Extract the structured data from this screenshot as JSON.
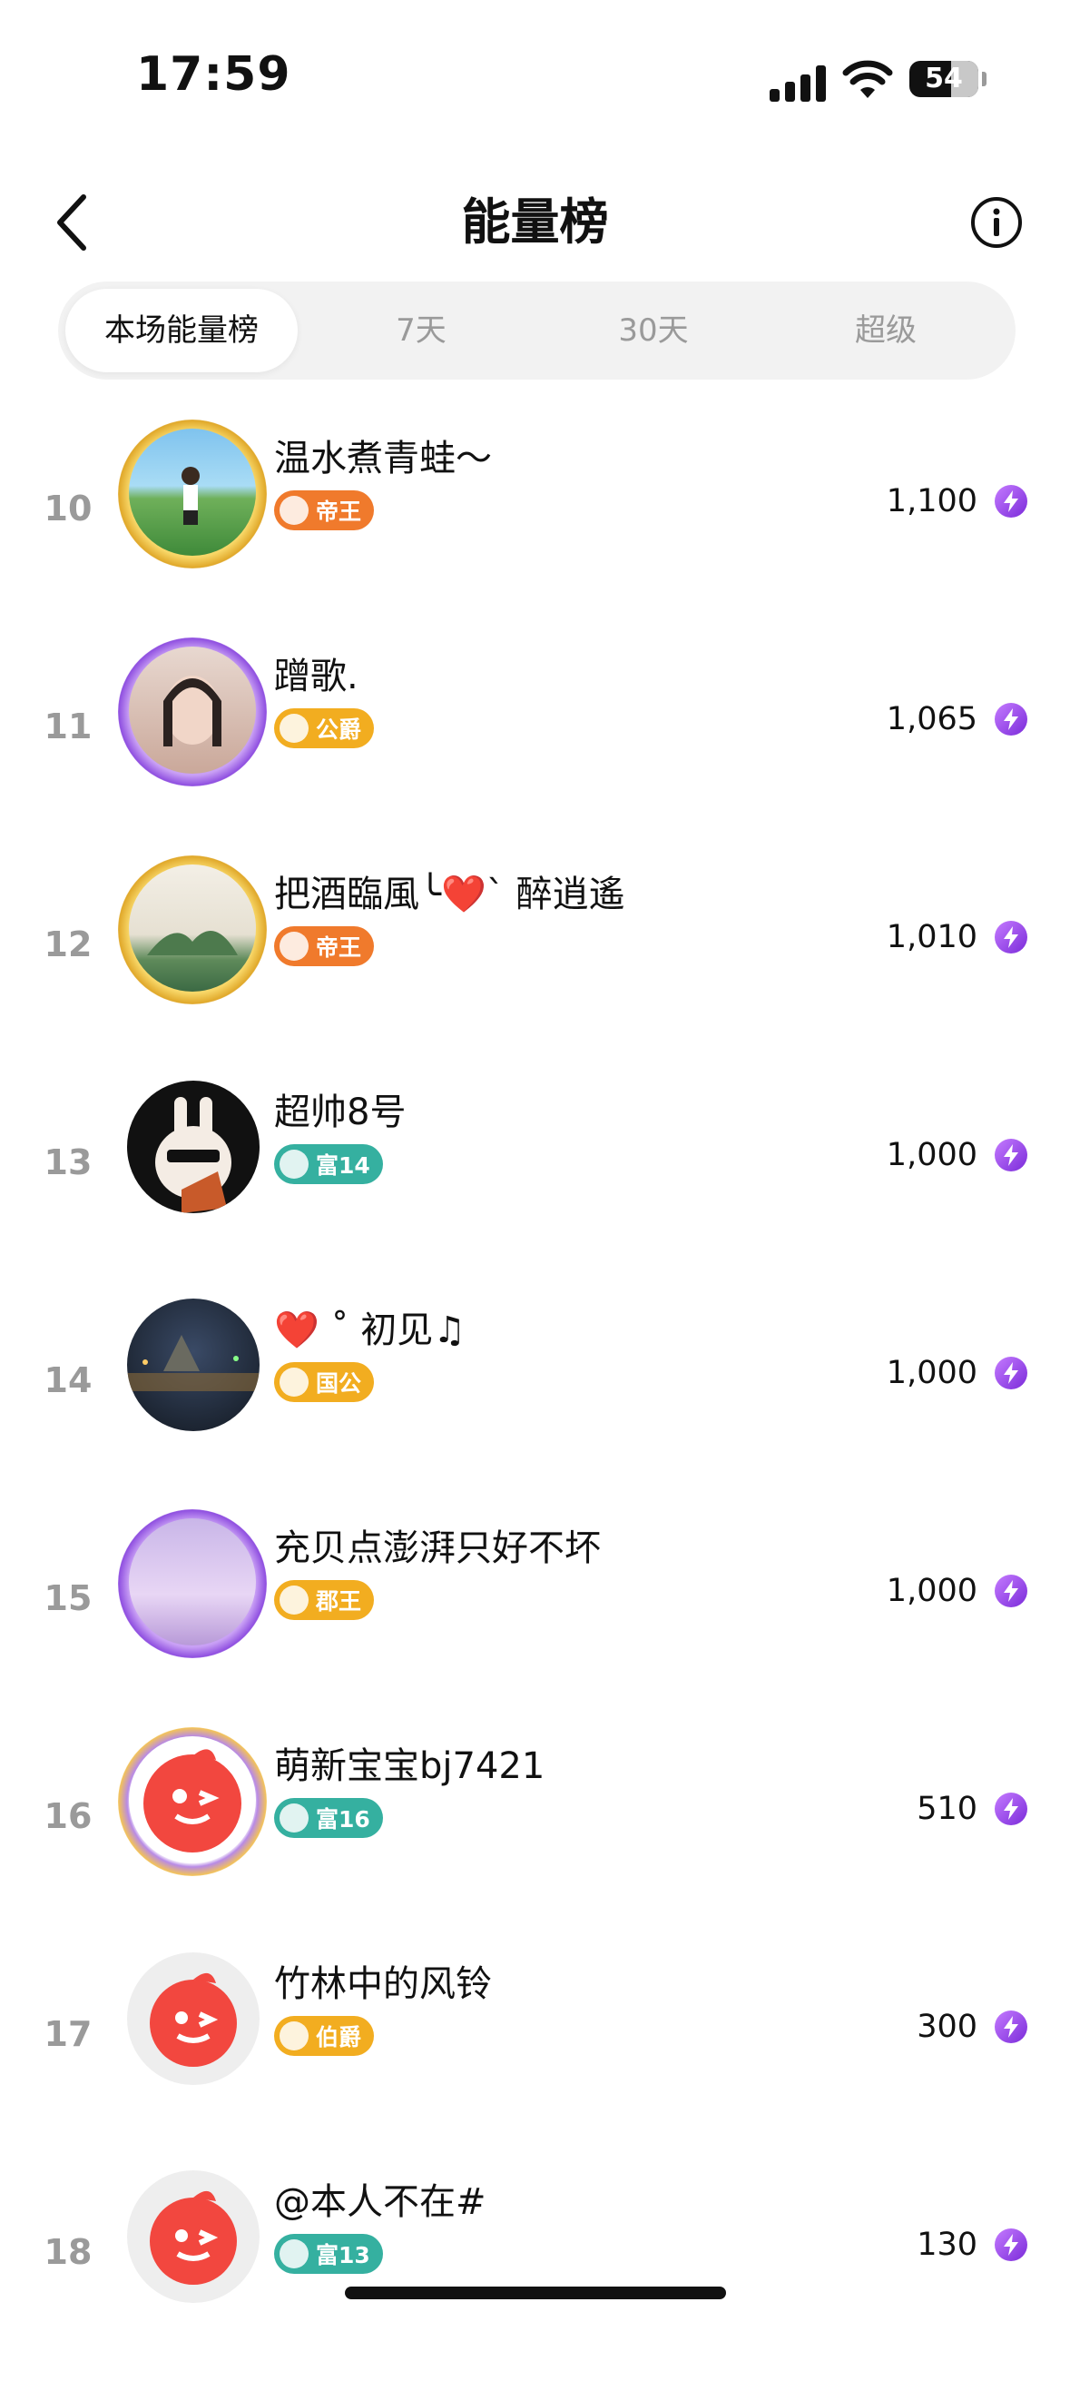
{
  "status_bar": {
    "time": "17:59",
    "battery": "54"
  },
  "header": {
    "title": "能量榜"
  },
  "tabs": [
    {
      "label": "本场能量榜",
      "active": true
    },
    {
      "label": "7天",
      "active": false
    },
    {
      "label": "30天",
      "active": false
    },
    {
      "label": "超级",
      "active": false
    }
  ],
  "rows": [
    {
      "rank": "10",
      "name": "温水煮青蛙～",
      "badge": "帝王",
      "badge_color": "#f07a2c",
      "score": "1,100"
    },
    {
      "rank": "11",
      "name": "蹭歌.",
      "badge": "公爵",
      "badge_color": "#f2ad20",
      "score": "1,065"
    },
    {
      "rank": "12",
      "name": "把酒臨風╰❤️ˋ 醉逍遙",
      "badge": "帝王",
      "badge_color": "#f07a2c",
      "score": "1,010"
    },
    {
      "rank": "13",
      "name": "超帅8号",
      "badge": "富14",
      "badge_color": "#35b0a0",
      "score": "1,000"
    },
    {
      "rank": "14",
      "name": "❤️ ˚ 初见♫",
      "badge": "国公",
      "badge_color": "#f2ad20",
      "score": "1,000"
    },
    {
      "rank": "15",
      "name": "充贝点澎湃只好不坏",
      "badge": "郡王",
      "badge_color": "#f2ad20",
      "score": "1,000"
    },
    {
      "rank": "16",
      "name": "萌新宝宝bj7421",
      "badge": "富16",
      "badge_color": "#35b0a0",
      "score": "510"
    },
    {
      "rank": "17",
      "name": "竹林中的风铃",
      "badge": "伯爵",
      "badge_color": "#f2ad20",
      "score": "300"
    },
    {
      "rank": "18",
      "name": "@本人不在#",
      "badge": "富13",
      "badge_color": "#35b0a0",
      "score": "130"
    }
  ]
}
